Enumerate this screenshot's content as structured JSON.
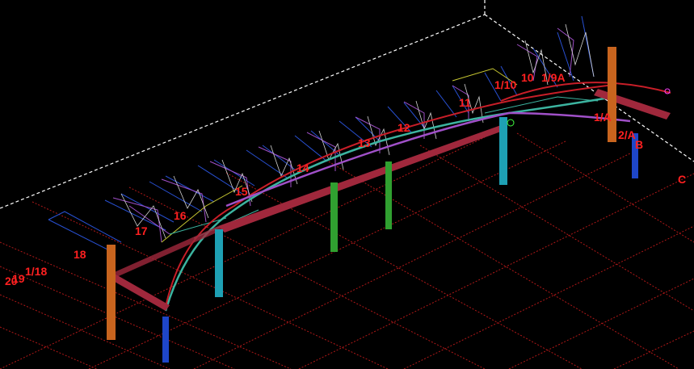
{
  "grid_labels": [
    {
      "id": "18",
      "text": "18"
    },
    {
      "id": "17",
      "text": "17"
    },
    {
      "id": "16",
      "text": "16"
    },
    {
      "id": "15",
      "text": "15"
    },
    {
      "id": "14",
      "text": "14"
    },
    {
      "id": "13",
      "text": "13"
    },
    {
      "id": "12",
      "text": "12"
    },
    {
      "id": "11",
      "text": "11"
    },
    {
      "id": "1_10",
      "text": "1/10"
    },
    {
      "id": "10",
      "text": "10"
    },
    {
      "id": "1_9A",
      "text": "1/9A"
    },
    {
      "id": "1A",
      "text": "1/A"
    },
    {
      "id": "2A",
      "text": "2/A"
    },
    {
      "id": "B",
      "text": "B"
    },
    {
      "id": "C",
      "text": "C"
    },
    {
      "id": "1_18",
      "text": "1/18"
    },
    {
      "id": "20",
      "text": "20"
    },
    {
      "id": "19",
      "text": "19"
    }
  ],
  "colors": {
    "background": "#000000",
    "grid": "#b01818",
    "dashed_boundary": "#ffffff",
    "label": "#ff2020",
    "beam": "#a0283c",
    "column_orange": "#c8641e",
    "column_teal": "#1ea0b4",
    "column_green": "#30a030",
    "column_blue": "#1e46c8",
    "arch_cyan": "#3cb4a0",
    "arch_red": "#c81e28",
    "truss_blue": "#2850d2",
    "truss_purple": "#a050c8",
    "truss_yellow": "#c8c832",
    "truss_white": "#d2d2d2"
  }
}
